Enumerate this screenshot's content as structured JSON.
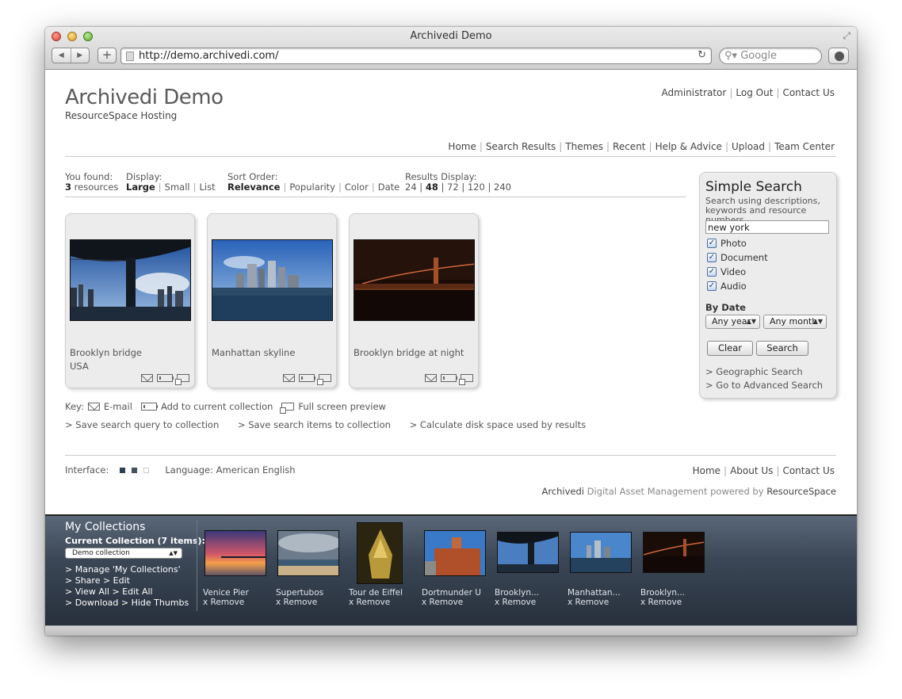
{
  "browser": {
    "window_title": "Archivedi Demo",
    "url": "http://demo.archivedi.com/",
    "search_placeholder": "Google"
  },
  "header": {
    "title": "Archivedi Demo",
    "subtitle": "ResourceSpace Hosting",
    "top_links": [
      "Administrator",
      "Log Out",
      "Contact Us"
    ],
    "nav": [
      "Home",
      "Search Results",
      "Themes",
      "Recent",
      "Help & Advice",
      "Upload",
      "Team Center"
    ]
  },
  "results_info": {
    "found_label": "You found:",
    "found_count": "3",
    "found_unit": "resources",
    "display_label": "Display:",
    "display_options": [
      "Large",
      "Small",
      "List"
    ],
    "sort_label": "Sort Order:",
    "sort_options": [
      "Relevance",
      "Popularity",
      "Color",
      "Date"
    ],
    "results_display_label": "Results Display:",
    "results_display_options": [
      "24",
      "48",
      "72",
      "120",
      "240"
    ]
  },
  "results": [
    {
      "title": "Brooklyn bridge",
      "subtitle": "USA"
    },
    {
      "title": "Manhattan skyline",
      "subtitle": ""
    },
    {
      "title": "Brooklyn bridge at night",
      "subtitle": ""
    }
  ],
  "key": {
    "label": "Key:",
    "email": "E-mail",
    "add": "Add to current collection",
    "preview": "Full screen preview"
  },
  "actions": [
    "> Save search query to collection",
    "> Save search items to collection",
    "> Calculate disk space used by results"
  ],
  "simple_search": {
    "title": "Simple Search",
    "description": "Search using descriptions, keywords and resource numbers",
    "query": "new york",
    "types": [
      "Photo",
      "Document",
      "Video",
      "Audio"
    ],
    "by_date_label": "By Date",
    "year_value": "Any year",
    "month_value": "Any month",
    "clear_label": "Clear",
    "search_label": "Search",
    "geo_link": "> Geographic Search",
    "advanced_link": "> Go to Advanced Search"
  },
  "footer": {
    "interface_label": "Interface:",
    "language": "Language: American English",
    "links": [
      "Home",
      "About Us",
      "Contact Us"
    ],
    "powered_brand": "Archivedi",
    "powered_mid": " Digital Asset Management powered by ",
    "powered_product": "ResourceSpace"
  },
  "collections": {
    "title": "My Collections",
    "current": "Current Collection (7 items):",
    "selected": "Demo collection",
    "links": [
      "> Manage 'My Collections'",
      "> Share   > Edit",
      "> View All   > Edit All",
      "> Download   > Hide Thumbs"
    ],
    "remove_label": "x Remove",
    "items": [
      "Venice Pier",
      "Supertubos",
      "Tour de Eiffel",
      "Dortmunder U",
      "Brooklyn...",
      "Manhattan...",
      "Brooklyn..."
    ]
  }
}
